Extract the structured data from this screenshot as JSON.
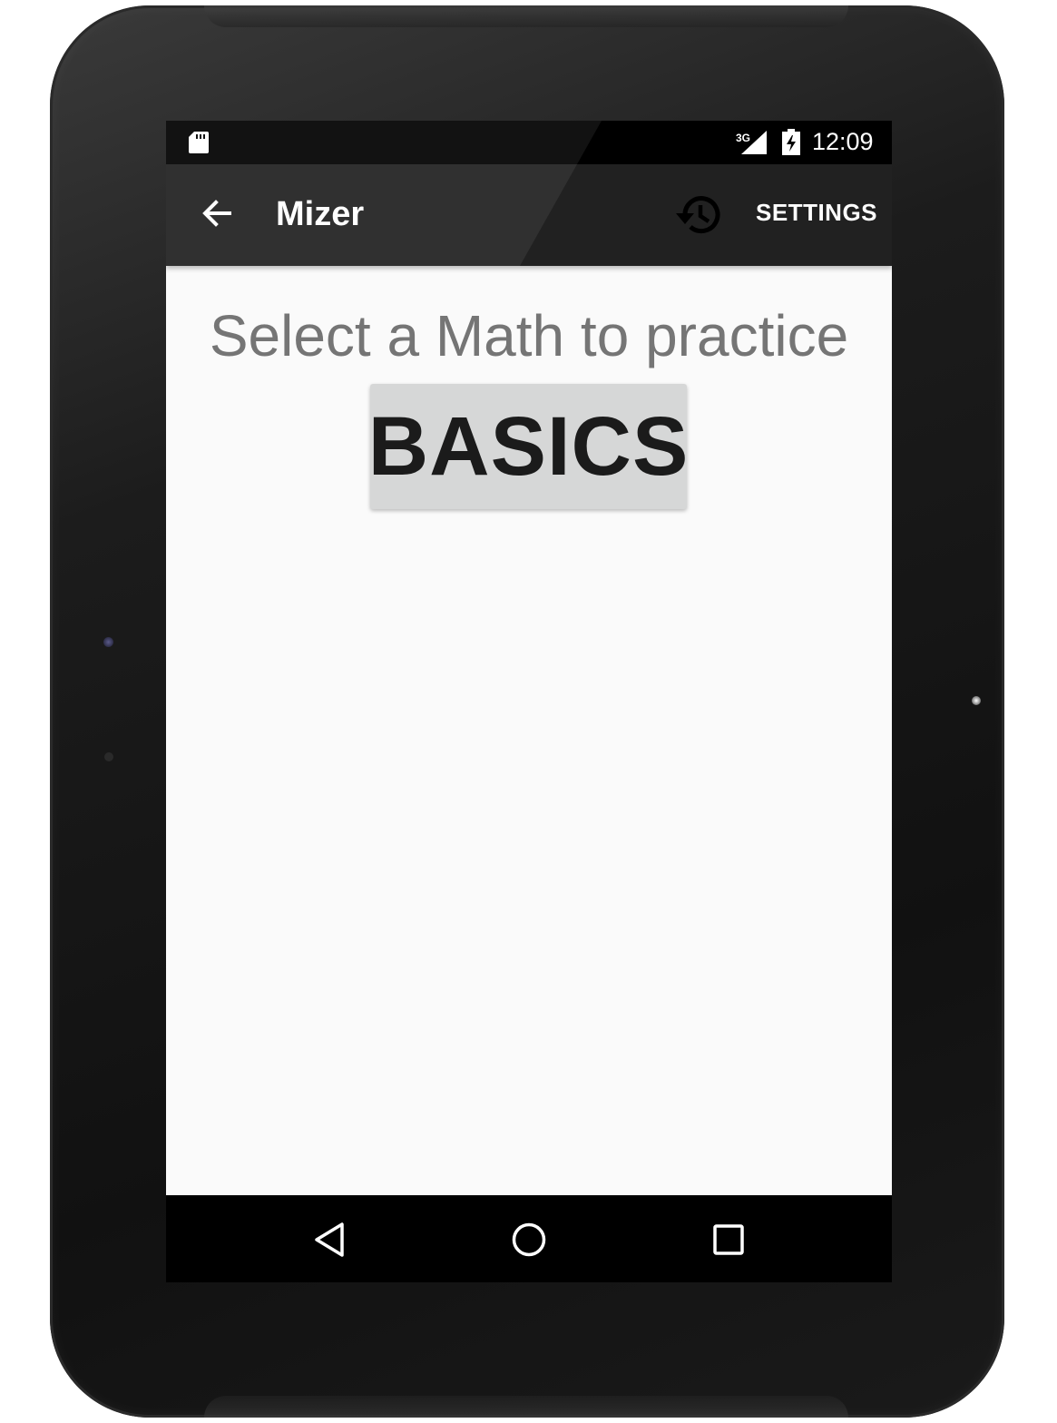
{
  "status_bar": {
    "network_label": "3G",
    "time": "12:09",
    "icons": [
      "sd-card-icon",
      "cell-signal-icon",
      "battery-charging-icon"
    ]
  },
  "toolbar": {
    "title": "Mizer",
    "back_icon": "arrow-back-icon",
    "history_icon": "history-icon",
    "settings_label": "SETTINGS",
    "background_color": "#212121"
  },
  "main": {
    "prompt": "Select a Math to practice",
    "options": [
      {
        "label": "BASICS"
      }
    ],
    "background_color": "#fafafa",
    "button_color": "#d6d7d7"
  },
  "nav_bar": {
    "icons": [
      "back-triangle-icon",
      "home-circle-icon",
      "recents-square-icon"
    ]
  }
}
